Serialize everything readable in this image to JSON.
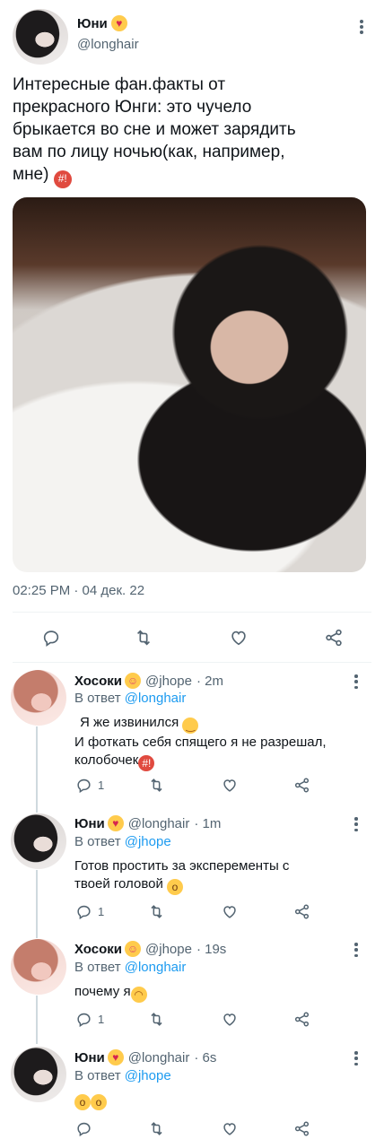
{
  "main_tweet": {
    "author": {
      "name": "Юни",
      "name_emoji": "smiling-face-with-hearts",
      "handle": "@longhair"
    },
    "text_lines": [
      "Интересные фан.факты от",
      "прекрасного Юнги: это чучело",
      "брыкается во сне и может зарядить",
      "вам по лицу ночью(как, например,",
      "мне)"
    ],
    "text_emoji": "face-with-symbols-on-mouth",
    "photo_alt_icon": "photo-sleeping-person",
    "timestamp": "02:25 PM · 04 дек. 22",
    "actions": [
      "reply-icon",
      "retweet-icon",
      "like-icon",
      "share-icon"
    ]
  },
  "replies": [
    {
      "name": "Хосоки",
      "name_emoji": "zany-face",
      "handle": "@jhope",
      "time": "· 2m",
      "reply_to_label": "В ответ",
      "reply_to_handle": "@longhair",
      "text_lines": [
        "Я же извинился",
        "И фоткать себя спящего я не разрешал,",
        "колобочек"
      ],
      "emojis": [
        "relieved-face",
        "face-with-symbols-on-mouth"
      ],
      "reply_count": "1"
    },
    {
      "name": "Юни",
      "name_emoji": "smiling-face-with-hearts",
      "handle": "@longhair",
      "time": "· 1m",
      "reply_to_label": "В ответ",
      "reply_to_handle": "@jhope",
      "text_lines": [
        "Готов простить за эксперементы с",
        "твоей головой"
      ],
      "emojis": [
        "hushed-face"
      ],
      "reply_count": "1"
    },
    {
      "name": "Хосоки",
      "name_emoji": "zany-face",
      "handle": "@jhope",
      "time": "· 19s",
      "reply_to_label": "В ответ",
      "reply_to_handle": "@longhair",
      "text_lines": [
        "почему я"
      ],
      "emojis": [
        "weary-face"
      ],
      "reply_count": "1"
    },
    {
      "name": "Юни",
      "name_emoji": "smiling-face-with-hearts",
      "handle": "@longhair",
      "time": "· 6s",
      "reply_to_label": "В ответ",
      "reply_to_handle": "@jhope",
      "text_lines": [],
      "emojis": [
        "hushed-face",
        "hushed-face"
      ],
      "reply_count": ""
    }
  ],
  "colors": {
    "text": "#0f1419",
    "secondary": "#536471",
    "mention": "#1d9bf0",
    "divider": "#eff3f4"
  }
}
